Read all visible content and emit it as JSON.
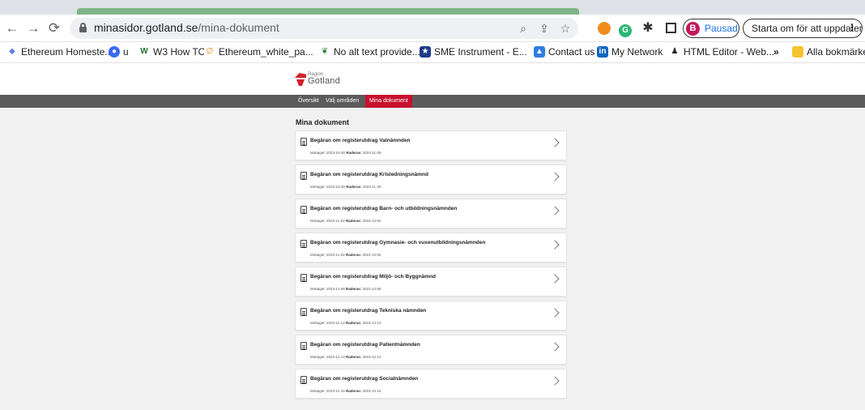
{
  "browser": {
    "url_host": "minasidor.gotland.se",
    "url_path": "/mina-dokument",
    "profile_initial": "B",
    "profile_label": "Pausad",
    "update_label": "Starta om för att uppdatera",
    "bookmarks": [
      "Ethereum Homeste...",
      "u",
      "W3 How TO",
      "Ethereum_white_pa...",
      "No alt text provide...",
      "SME Instrument - E...",
      "Contact us",
      "My Network",
      "HTML Editor - Web...",
      "»",
      "Alla bokmärken"
    ]
  },
  "site": {
    "logo_region": "Region",
    "logo_name": "Gotland",
    "nav": [
      "Översikt",
      "Välj områden",
      "Mina dokument"
    ],
    "active_nav": "Mina dokument"
  },
  "main": {
    "title": "Mina dokument",
    "received_label": "Mottaget:",
    "delete_label": "Raderas:",
    "documents": [
      {
        "title": "Begäran om registerutdrag Valnämnden",
        "received": "2023-10-30",
        "delete": "2023-11-29"
      },
      {
        "title": "Begäran om registerutdrag Krisledningsnämnd",
        "received": "2023-10-30",
        "delete": "2023-11-29"
      },
      {
        "title": "Begäran om registerutdrag Barn- och utbildningsnämnden",
        "received": "2023-11-02",
        "delete": "2023-12-02"
      },
      {
        "title": "Begäran om registerutdrag Gymnasie- och vuxenutbildningsnämnden",
        "received": "2023-11-02",
        "delete": "2023-12-02"
      },
      {
        "title": "Begäran om registerutdrag Miljö- och Byggnämnd",
        "received": "2023-11-08",
        "delete": "2023-12-08"
      },
      {
        "title": "Begäran om registerutdrag Tekniska nämnden",
        "received": "2023-11-13",
        "delete": "2023-12-13"
      },
      {
        "title": "Begäran om registerutdrag Patientnämnden",
        "received": "2023-11-13",
        "delete": "2023-12-13"
      },
      {
        "title": "Begäran om registerutdrag Socialnämnden",
        "received": "2023-11-15",
        "delete": "2023-12-15"
      }
    ]
  }
}
